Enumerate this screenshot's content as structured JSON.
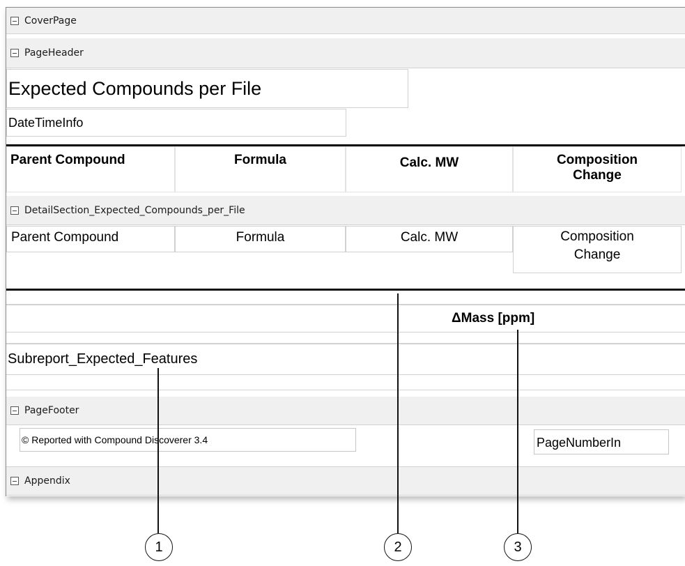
{
  "bands": {
    "cover_page": "CoverPage",
    "page_header": "PageHeader",
    "detail_section": "DetailSection_Expected_Compounds_per_File",
    "page_footer": "PageFooter",
    "appendix": "Appendix"
  },
  "page_header": {
    "title": "Expected Compounds per File",
    "date_time": "DateTimeInfo"
  },
  "column_headers": [
    "Parent Compound",
    "Formula",
    "Calc. MW",
    "Composition Change"
  ],
  "detail_fields": [
    "Parent Compound",
    "Formula",
    "Calc. MW",
    "Composition Change"
  ],
  "group_footer": {
    "delta_mass_header": "ΔMass [ppm]",
    "subreport": "Subreport_Expected_Features"
  },
  "page_footer": {
    "copyright": "© Reported with Compound Discoverer 3.4",
    "page_number": "PageNumberIn"
  },
  "callouts": [
    "1",
    "2",
    "3"
  ]
}
